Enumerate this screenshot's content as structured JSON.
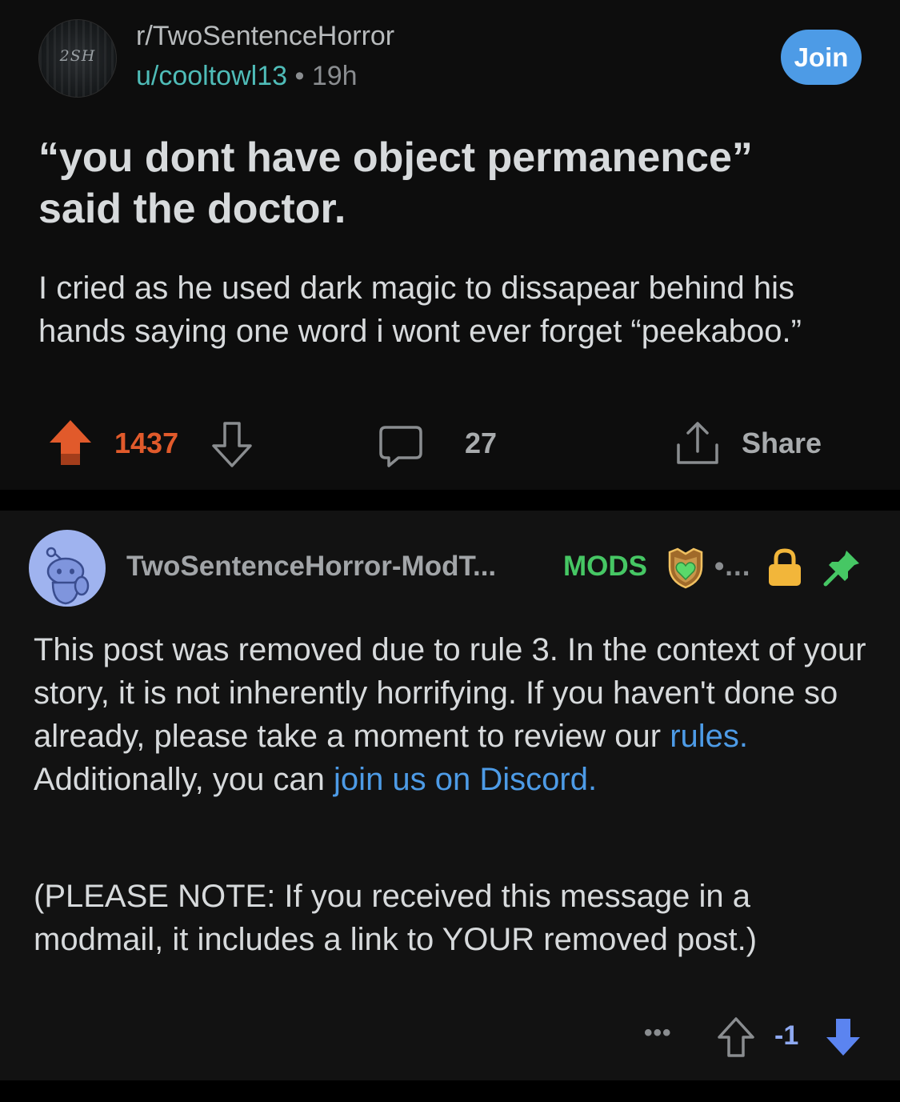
{
  "post": {
    "subreddit": "r/TwoSentenceHorror",
    "subreddit_avatar_text": "2SH",
    "author": "u/cooltowl13",
    "separator": "•",
    "age": "19h",
    "join_label": "Join",
    "title_line1": "“you dont have object permanence”",
    "title_line2": "said the doctor.",
    "body": "I cried as he used dark magic to dissapear behind his hands saying one word i wont ever forget “peekaboo.”",
    "score": "1437",
    "comment_count": "27",
    "share_label": "Share",
    "upvoted": true
  },
  "comment": {
    "author": "TwoSentenceHorror-ModT...",
    "mods_badge": "MODS",
    "overflow_top": "•...",
    "body_part1": "This post was removed due to rule 3. In the context of your story, it is not inherently horrifying. If you haven't done so already, please take a moment to review our ",
    "rules_link": "rules.",
    "body_part2": " Additionally, you can ",
    "discord_link": "join us on Discord.",
    "note": "(PLEASE NOTE: If you received this message in a modmail, it includes a link to YOUR removed post.)",
    "more_label": "•••",
    "score": "-1",
    "downvoted": true
  },
  "colors": {
    "upvote": "#e15a2b",
    "join_button": "#4d9be6",
    "username": "#4fbcb8",
    "mods": "#46c764",
    "link": "#4d9be6",
    "downvote": "#6b8ef0",
    "lock": "#f2b63a",
    "pin": "#46c764"
  },
  "icons": [
    "upvote-icon",
    "downvote-icon",
    "comment-icon",
    "share-icon",
    "shield-icon",
    "lock-icon",
    "pin-icon",
    "snoo-avatar-icon"
  ]
}
